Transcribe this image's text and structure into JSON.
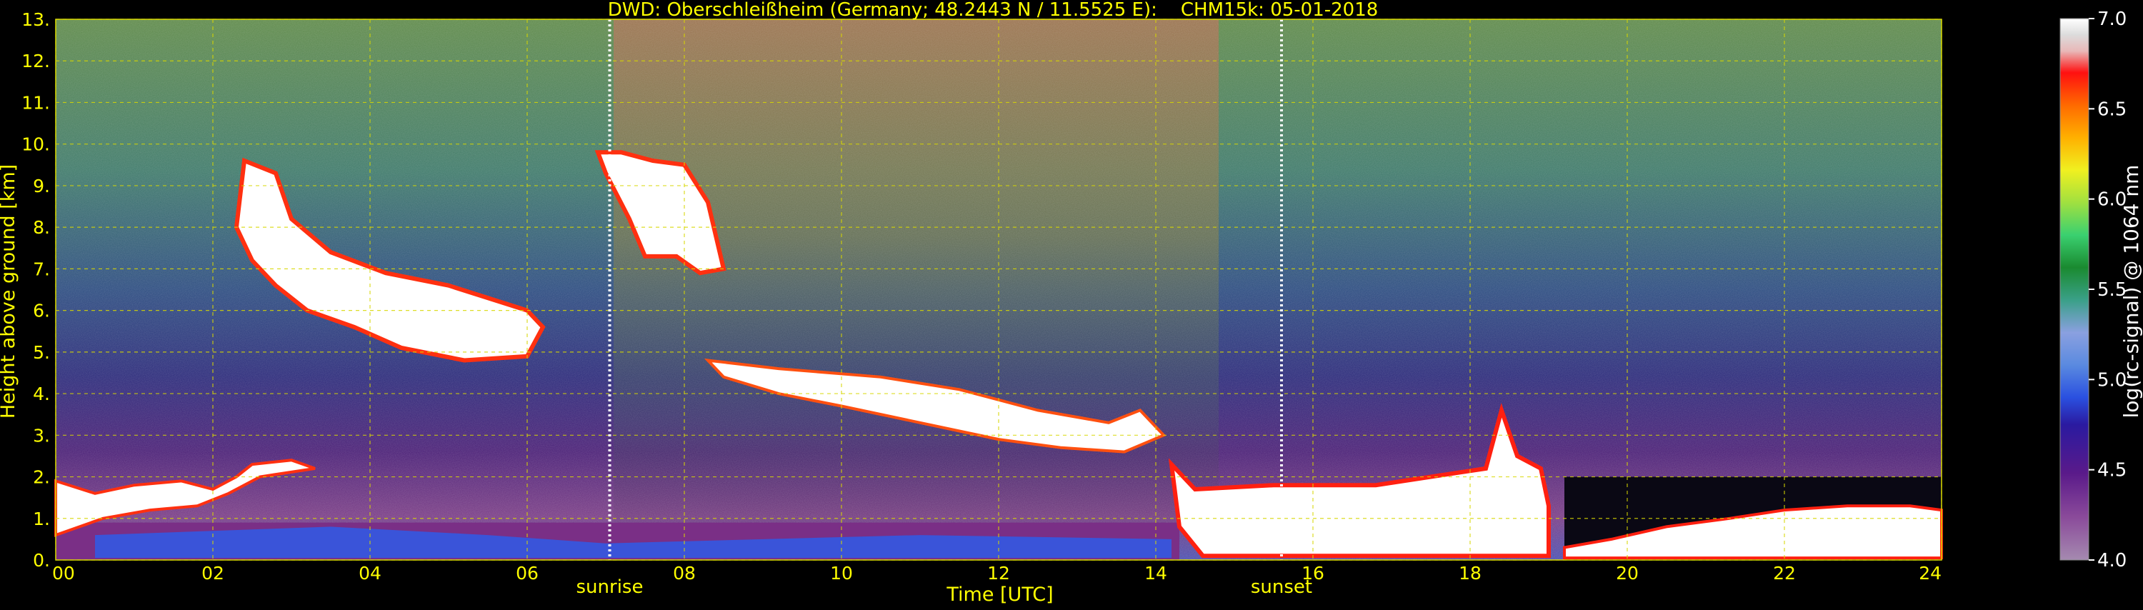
{
  "title": "DWD: Oberschleißheim (Germany; 48.2443 N / 11.5525 E):    CHM15k: 05-01-2018",
  "chart_data": {
    "type": "heatmap",
    "title": "DWD: Oberschleißheim (Germany; 48.2443 N / 11.5525 E):    CHM15k: 05-01-2018",
    "xlabel": "Time [UTC]",
    "ylabel": "Height above ground [km]",
    "xlim": [
      0,
      24
    ],
    "ylim": [
      0,
      13
    ],
    "x_ticks": [
      "00",
      "02",
      "04",
      "06",
      "08",
      "10",
      "12",
      "14",
      "16",
      "18",
      "20",
      "22",
      "24"
    ],
    "y_ticks": [
      "0.",
      "1.",
      "2.",
      "3.",
      "4.",
      "5.",
      "6.",
      "7.",
      "8.",
      "9.",
      "10.",
      "11.",
      "12.",
      "13."
    ],
    "grid": true,
    "markers": [
      {
        "label": "sunrise",
        "x": 7.05
      },
      {
        "label": "sunset",
        "x": 15.6
      }
    ],
    "colorbar": {
      "label": "log(rc-signal) @ 1064 nm",
      "range": [
        4.0,
        7.0
      ],
      "ticks": [
        "4.0",
        "4.5",
        "5.0",
        "5.5",
        "6.0",
        "6.5",
        "7.0"
      ]
    },
    "colors": {
      "text": "#ffff00",
      "grid": "#d8d800",
      "marker": "#ffffff"
    }
  }
}
